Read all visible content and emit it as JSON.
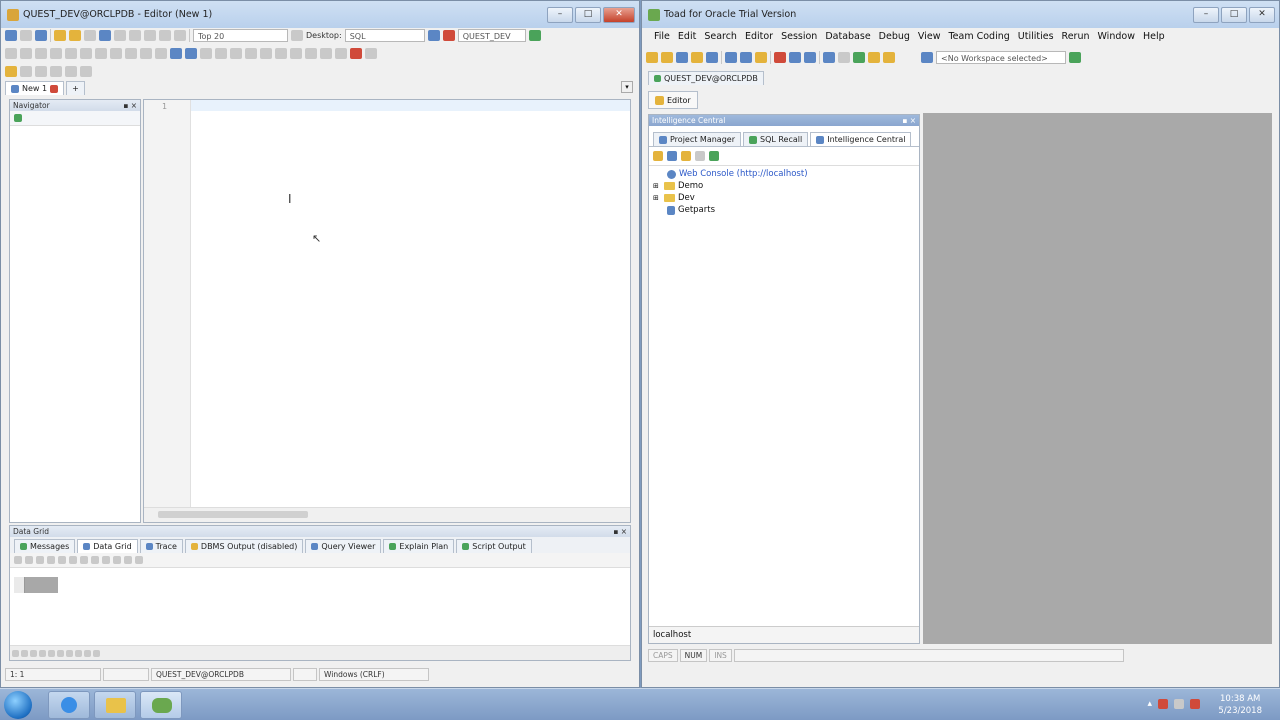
{
  "left_window": {
    "title": "QUEST_DEV@ORCLPDB - Editor (New 1)",
    "toolbar": {
      "top_dropdown": "Top 20",
      "desktop_label": "Desktop:",
      "desktop_value": "SQL",
      "connection_value": "QUEST_DEV"
    },
    "doc_tab": "New 1",
    "navigator": {
      "title": "Navigator"
    },
    "editor": {
      "line_number": "1"
    },
    "data_grid": {
      "title": "Data Grid",
      "tabs": [
        "Messages",
        "Data Grid",
        "Trace",
        "DBMS Output (disabled)",
        "Query Viewer",
        "Explain Plan",
        "Script Output"
      ]
    },
    "status": {
      "position": "1:  1",
      "connection": "QUEST_DEV@ORCLPDB",
      "line_ending": "Windows (CRLF)"
    }
  },
  "right_window": {
    "title": "Toad for Oracle Trial Version",
    "menu": [
      "File",
      "Edit",
      "Search",
      "Editor",
      "Session",
      "Database",
      "Debug",
      "View",
      "Team Coding",
      "Utilities",
      "Rerun",
      "Window",
      "Help"
    ],
    "workspace": "<No Workspace selected>",
    "connection_tab": "QUEST_DEV@ORCLPDB",
    "editor_button": "Editor",
    "intelligence_central": {
      "title": "Intelligence Central",
      "tabs": [
        "Project Manager",
        "SQL Recall",
        "Intelligence Central"
      ],
      "tree": [
        {
          "label": "Web Console (http://localhost)",
          "kind": "link"
        },
        {
          "label": "Demo",
          "kind": "folder"
        },
        {
          "label": "Dev",
          "kind": "folder"
        },
        {
          "label": "Getparts",
          "kind": "item"
        }
      ],
      "footer": "localhost"
    },
    "status": {
      "caps": "CAPS",
      "num": "NUM",
      "ins": "INS"
    }
  },
  "taskbar": {
    "time": "10:38 AM",
    "date": "5/23/2018"
  },
  "colors": {
    "titlebar": "#c4d8ef",
    "accent_blue": "#2b58c8",
    "grey_area": "#a9a9a9"
  }
}
